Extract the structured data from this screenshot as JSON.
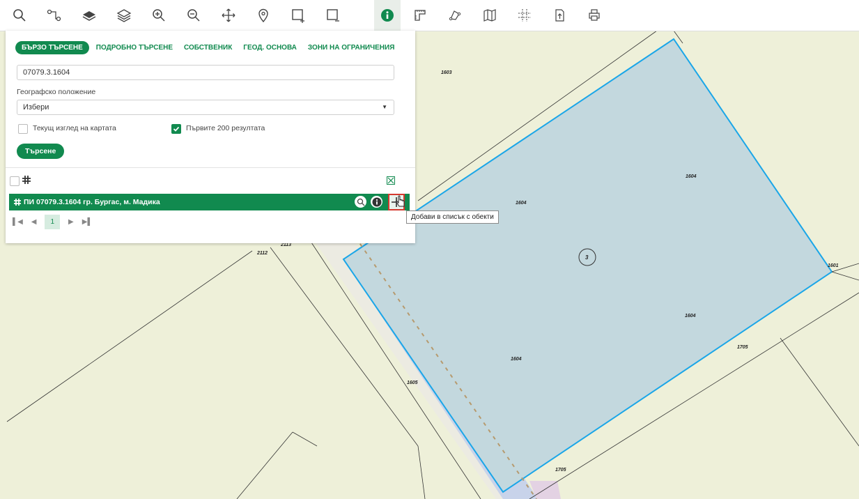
{
  "toolbar": {
    "tools": [
      {
        "name": "search-tool",
        "icon": "search-icon",
        "active": false
      },
      {
        "name": "route-tool",
        "icon": "route-icon",
        "active": false
      },
      {
        "name": "layer-tool",
        "icon": "layer-icon",
        "active": false
      },
      {
        "name": "layers-tool",
        "icon": "layers-icon",
        "active": false
      },
      {
        "name": "zoom-in-tool",
        "icon": "zoom-in-icon",
        "active": false
      },
      {
        "name": "zoom-out-tool",
        "icon": "zoom-out-icon",
        "active": false
      },
      {
        "name": "pan-tool",
        "icon": "pan-icon",
        "active": false
      },
      {
        "name": "location-tool",
        "icon": "location-pin-icon",
        "active": false
      },
      {
        "name": "select-add-tool",
        "icon": "select-add-icon",
        "active": false
      },
      {
        "name": "select-remove-tool",
        "icon": "select-remove-icon",
        "active": false
      },
      {
        "name": "info-tool",
        "icon": "info-icon",
        "active": true
      },
      {
        "name": "measure-tool",
        "icon": "ruler-icon",
        "active": false
      },
      {
        "name": "polygon-tool",
        "icon": "polygon-icon",
        "active": false
      },
      {
        "name": "map-tool",
        "icon": "map-icon",
        "active": false
      },
      {
        "name": "grid-tool",
        "icon": "grid-icon",
        "active": false
      },
      {
        "name": "export-tool",
        "icon": "export-icon",
        "active": false
      },
      {
        "name": "print-tool",
        "icon": "print-icon",
        "active": false
      }
    ]
  },
  "panel": {
    "tabs": [
      "БЪРЗО ТЪРСЕНЕ",
      "ПОДРОБНО ТЪРСЕНЕ",
      "СОБСТВЕНИК",
      "ГЕОД. ОСНОВА",
      "ЗОНИ НА ОГРАНИЧЕНИЯ"
    ],
    "search_value": "07079.3.1604",
    "geo_label": "Географско положение",
    "geo_select": "Избери",
    "checkbox_current_view": "Текущ изглед на картата",
    "checkbox_first_200": "Първите 200 резултата",
    "search_button": "Търсене",
    "result_text": "ПИ 07079.3.1604 гр. Бургас, м. Мадика",
    "page_current": "1",
    "tooltip": "Добави в списък с обекти"
  },
  "map": {
    "labels": [
      "1603",
      "1604",
      "1604",
      "1604",
      "1604",
      "1601",
      "1705",
      "1705",
      "1605",
      "2113",
      "2112",
      "3"
    ],
    "colors": {
      "background": "#eef0d9",
      "parcel_fill": "#c3d8de",
      "parcel_stroke": "#1aa6e8",
      "road_fill": "#c8d3ea",
      "brand": "#118a4f"
    }
  }
}
